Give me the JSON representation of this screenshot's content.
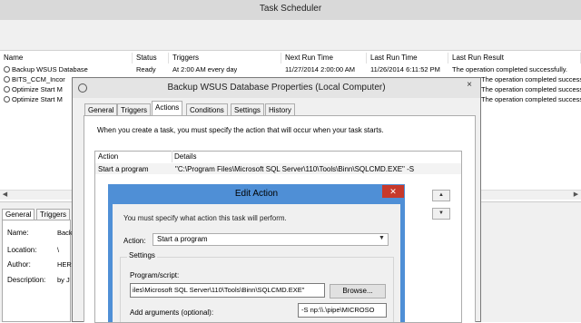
{
  "window": {
    "title": "Task Scheduler"
  },
  "task_list": {
    "columns": [
      "Name",
      "Status",
      "Triggers",
      "Next Run Time",
      "Last Run Time",
      "Last Run Result"
    ],
    "rows": [
      [
        "Backup WSUS Database",
        "Ready",
        "At 2:00 AM every day",
        "11/27/2014 2:00:00 AM",
        "11/26/2014 6:11:52 PM",
        "The operation completed successfully."
      ],
      [
        "BITS_CCM_Incor",
        "",
        "",
        "",
        "",
        "The operation completed successfully."
      ],
      [
        "Optimize Start M",
        "",
        "",
        "",
        "",
        "The operation completed successfully."
      ],
      [
        "Optimize Start M",
        "",
        "",
        "",
        "",
        "The operation completed successfully."
      ]
    ]
  },
  "details": {
    "tabs": [
      "General",
      "Triggers"
    ],
    "fields": [
      {
        "label": "Name:",
        "value": "Back"
      },
      {
        "label": "Location:",
        "value": "\\"
      },
      {
        "label": "Author:",
        "value": "HER"
      },
      {
        "label": "Description:",
        "value": "by J"
      }
    ]
  },
  "properties_dialog": {
    "title": "Backup WSUS Database Properties (Local Computer)",
    "close_label": "×",
    "tabs": [
      "General",
      "Triggers",
      "Actions",
      "Conditions",
      "Settings",
      "History"
    ],
    "active_tab": "Actions",
    "actions_description": "When you create a task, you must specify the action that will occur when your task starts.",
    "list_headers": {
      "action": "Action",
      "details": "Details"
    },
    "action_row": {
      "action": "Start a program",
      "details": "\"C:\\Program Files\\Microsoft SQL Server\\110\\Tools\\Binn\\SQLCMD.EXE\" -S"
    },
    "move_up": "▲",
    "move_down": "▼"
  },
  "edit_action_dialog": {
    "title": "Edit Action",
    "close_label": "✕",
    "description": "You must specify what action this task will perform.",
    "action_label": "Action:",
    "action_value": "Start a program",
    "settings_label": "Settings",
    "program_label": "Program/script:",
    "program_value": "iles\\Microsoft SQL Server\\110\\Tools\\Binn\\SQLCMD.EXE\"",
    "browse_label": "Browse...",
    "args_label": "Add arguments (optional):",
    "args_value": "-S np:\\\\.\\pipe\\MICROSO"
  },
  "colors": {
    "edit_titlebar": "#4f8fd6",
    "close_red": "#c7392b"
  },
  "icons": {
    "task": "clock-icon",
    "scroll_left": "arrow-left-icon",
    "scroll_right": "arrow-right-icon",
    "dropdown": "chevron-down-icon"
  }
}
